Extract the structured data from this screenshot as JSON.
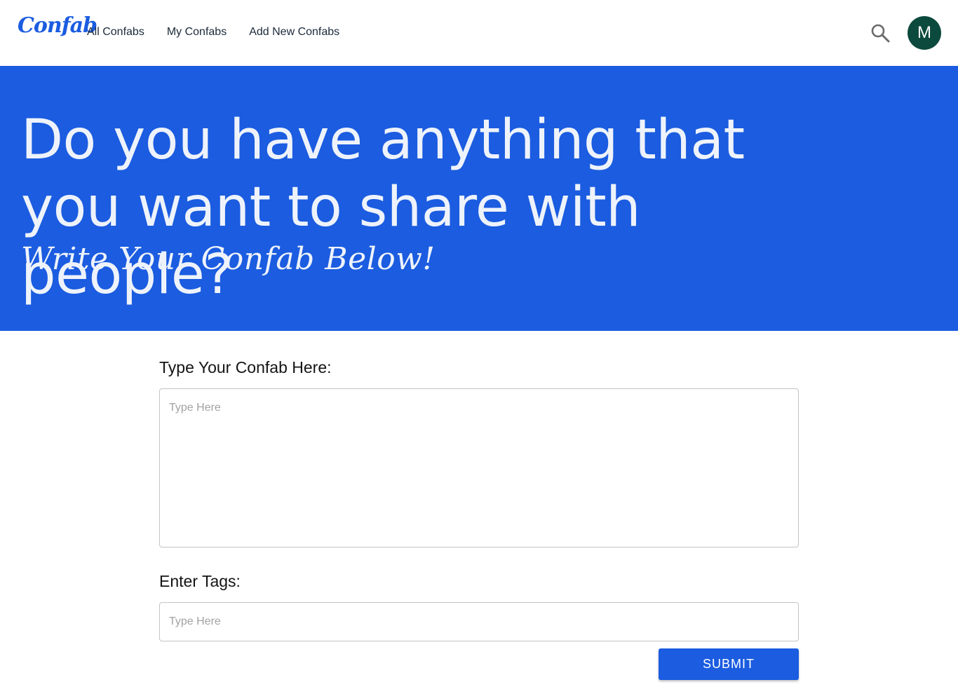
{
  "app": {
    "logo_text": "Confab",
    "brand_color": "#1b5ce0",
    "avatar_color": "#0c4a3d"
  },
  "nav": {
    "links": [
      {
        "label": "All Confabs"
      },
      {
        "label": "My Confabs"
      },
      {
        "label": "Add New Confabs"
      }
    ],
    "search_icon": "search-icon",
    "avatar_initial": "M"
  },
  "hero": {
    "title": "Do you have anything that you want to share with people?",
    "subtitle": "Write Your Confab Below!"
  },
  "form": {
    "confab_label": "Type Your Confab Here:",
    "confab_placeholder": "Type Here",
    "confab_value": "",
    "tags_label": "Enter Tags:",
    "tags_placeholder": "Type Here",
    "tags_value": "",
    "submit_label": "SUBMIT"
  }
}
